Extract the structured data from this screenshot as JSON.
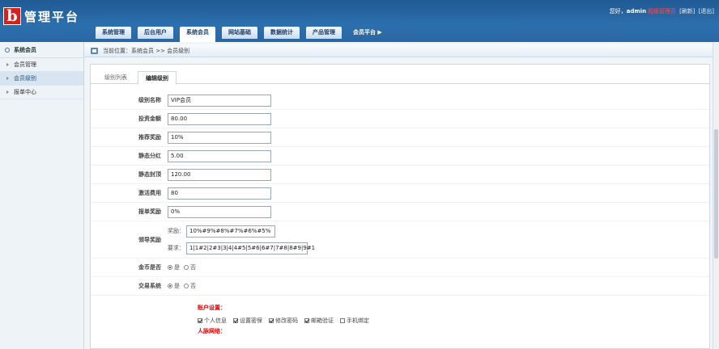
{
  "logo": {
    "mark": "b",
    "title": "管理平台"
  },
  "user_bar": {
    "greeting": "您好，",
    "username": "admin",
    "warning": "超级管理员",
    "refresh": "[刷新]",
    "logout": "[退出]"
  },
  "nav": {
    "tabs": [
      "系统管理",
      "后台用户",
      "系统会员",
      "网站基础",
      "数据统计",
      "产品管理"
    ],
    "active_index": 2,
    "more": "会员平台 ▶"
  },
  "sidebar": {
    "header": "系统会员",
    "items": [
      {
        "label": "会员管理",
        "active": false
      },
      {
        "label": "会员级别",
        "active": true
      },
      {
        "label": "报单中心",
        "active": false
      }
    ]
  },
  "breadcrumb": "当前位置：系统会员 >> 会员级别",
  "tabs": {
    "list": "级别列表",
    "edit": "编辑级别"
  },
  "form": {
    "fields": [
      {
        "label": "级别名称",
        "value": "VIP会员"
      },
      {
        "label": "投资金额",
        "value": "80.00"
      },
      {
        "label": "推荐奖励",
        "value": "10%"
      },
      {
        "label": "静态分红",
        "value": "5.00"
      },
      {
        "label": "静态封顶",
        "value": "120.00"
      },
      {
        "label": "激活费用",
        "value": "80"
      },
      {
        "label": "报单奖励",
        "value": "0%"
      }
    ],
    "leader": {
      "label": "领导奖励",
      "reward_label": "奖励：",
      "reward_value": "10%#9%#8%#7%#6%#5%",
      "require_label": "要求：",
      "require_value": "1|1#2|2#3|3|4|4#5|5#6|6#7|7#8|8#9|9#1"
    },
    "gold_online": {
      "label": "金币是否",
      "opt_yes": "是",
      "opt_no": "否",
      "selected": "是"
    },
    "trade_system": {
      "label": "交易系统",
      "opt_yes": "是",
      "opt_no": "否",
      "selected": "是"
    },
    "account_settings": {
      "title": "账户设置：",
      "checks": [
        {
          "label": "个人信息",
          "checked": true
        },
        {
          "label": "设置密保",
          "checked": true
        },
        {
          "label": "修改密码",
          "checked": true
        },
        {
          "label": "邮箱验证",
          "checked": true
        },
        {
          "label": "手机绑定",
          "checked": false
        }
      ]
    },
    "network_title": "人脉网络："
  }
}
